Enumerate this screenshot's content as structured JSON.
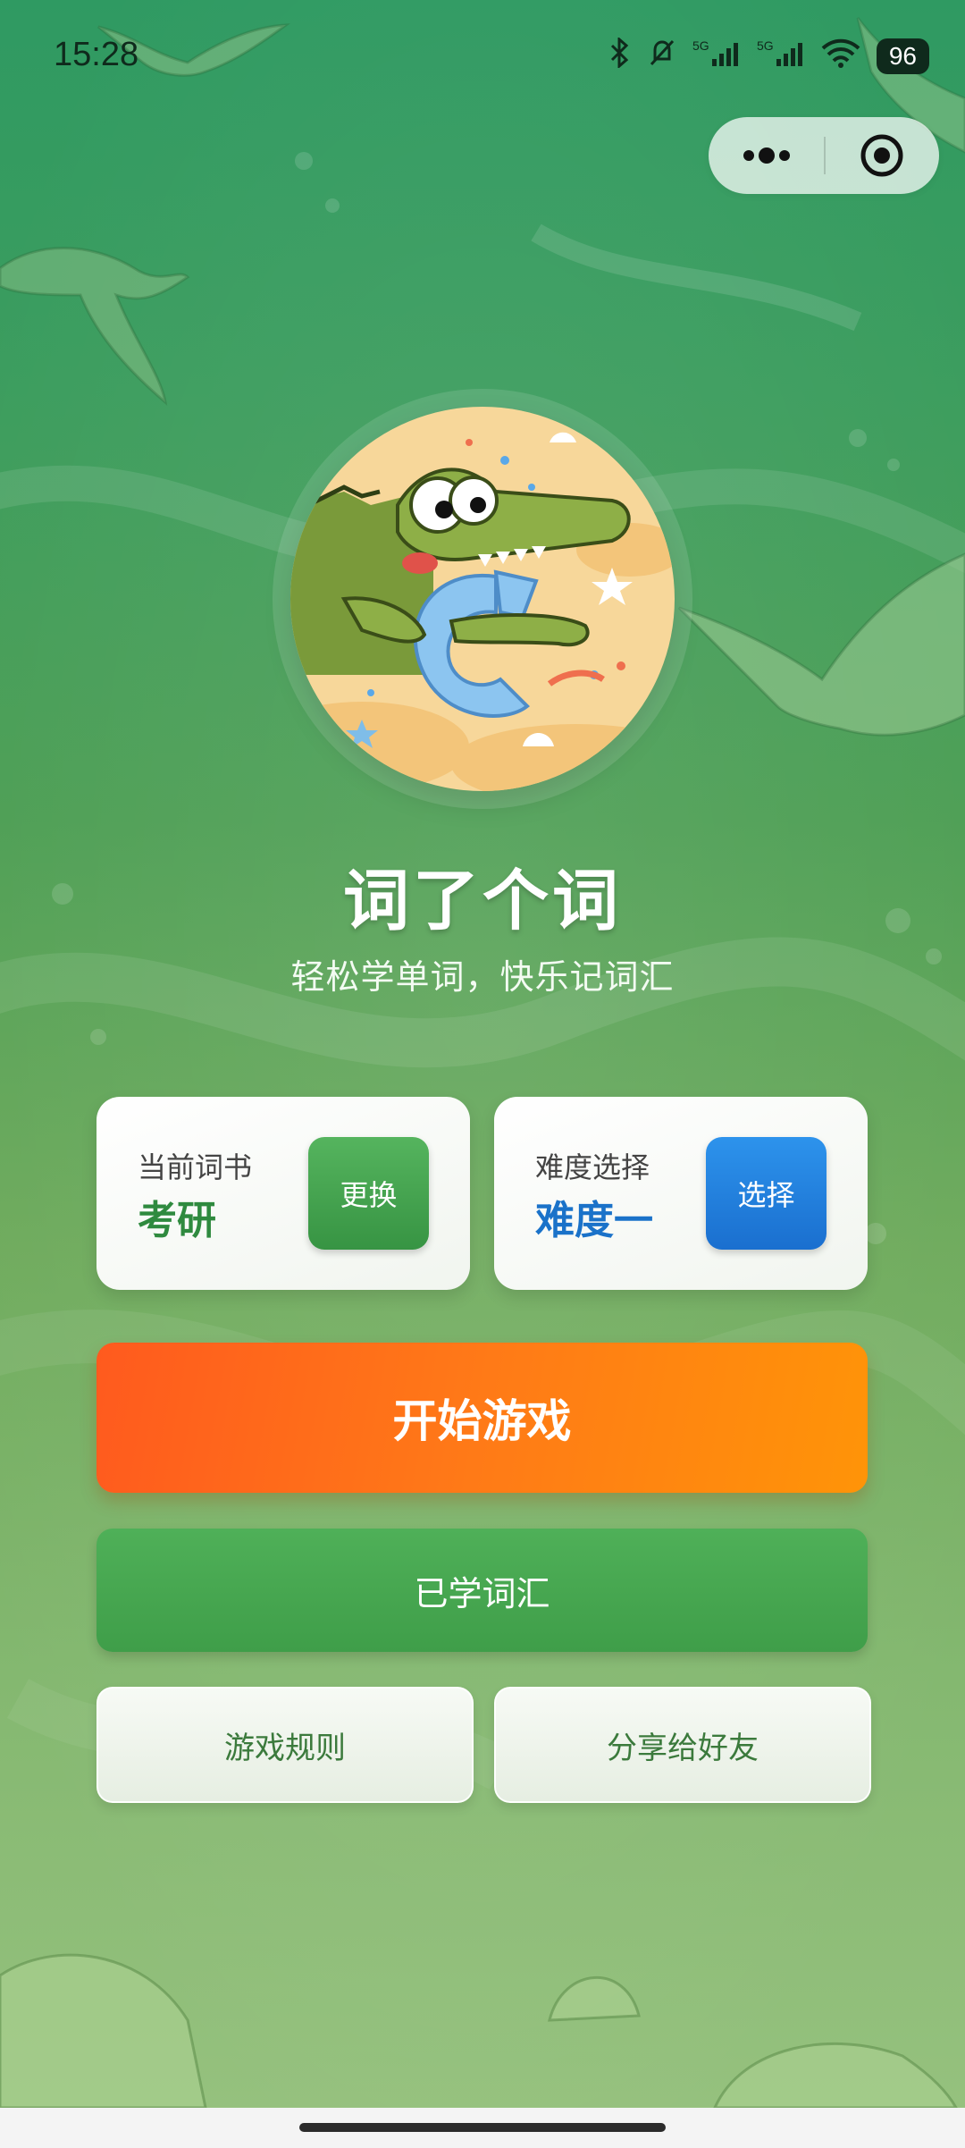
{
  "status_bar": {
    "time": "15:28",
    "battery": "96",
    "icons": [
      "bluetooth-icon",
      "mute-icon",
      "5g-signal-icon",
      "5g-signal-icon",
      "wifi-icon",
      "battery-icon"
    ]
  },
  "app": {
    "title": "词了个词",
    "subtitle": "轻松学单词，快乐记词汇",
    "logo": "crocodile-logo"
  },
  "book_card": {
    "label": "当前词书",
    "value": "考研",
    "button": "更换"
  },
  "level_card": {
    "label": "难度选择",
    "value": "难度一",
    "button": "选择"
  },
  "buttons": {
    "start": "开始游戏",
    "learned": "已学词汇",
    "rules": "游戏规则",
    "share": "分享给好友"
  },
  "colors": {
    "start_button": "#ff7a17",
    "book_value": "#2f8a3f",
    "level_value": "#1a72c9",
    "background_top": "#2f9a62",
    "background_bottom": "#97c27f"
  }
}
